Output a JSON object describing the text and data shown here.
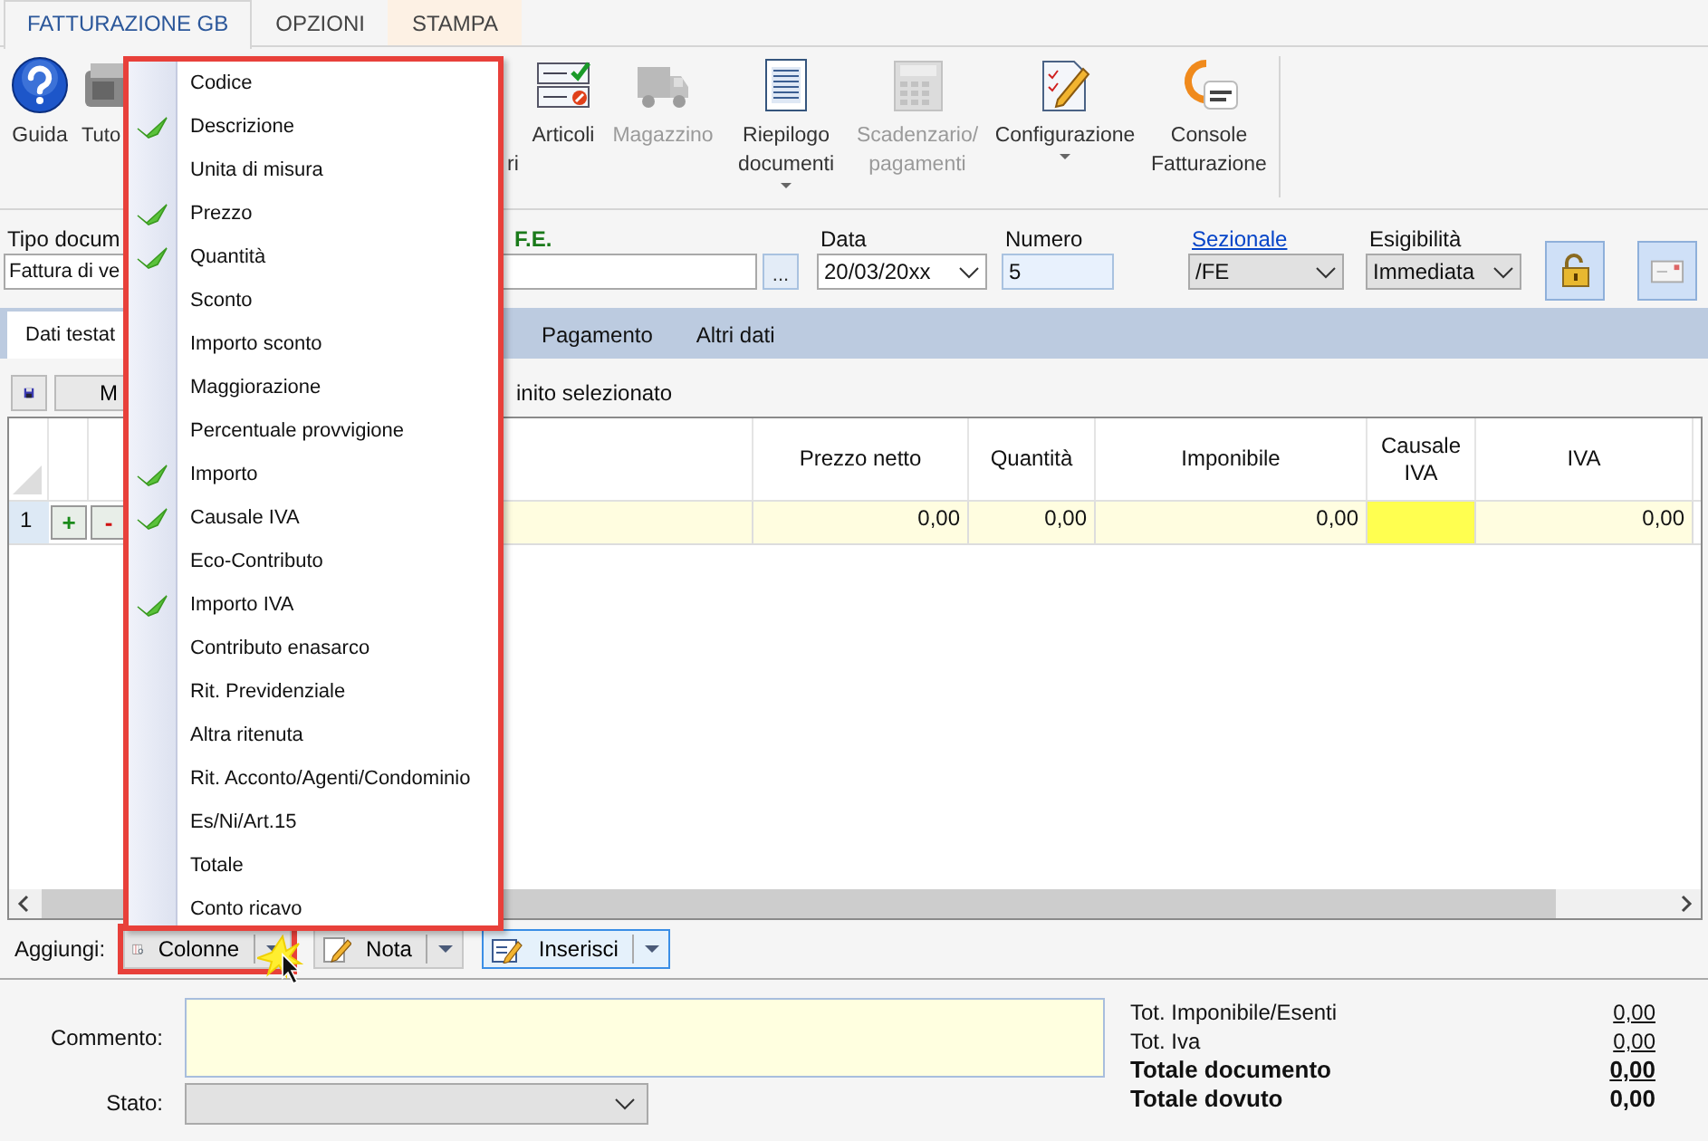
{
  "ribbon_tabs": [
    {
      "label": "FATTURAZIONE GB",
      "selected": true,
      "kind": "normal"
    },
    {
      "label": "OPZIONI",
      "selected": false,
      "kind": "normal"
    },
    {
      "label": "STAMPA",
      "selected": false,
      "kind": "contextual"
    }
  ],
  "ribbon_buttons": [
    {
      "kind": "help",
      "lines": [
        "Guida"
      ],
      "disabled": false,
      "dropdown": false
    },
    {
      "kind": "register",
      "lines": [
        "Tuto"
      ],
      "disabled": false,
      "dropdown": false
    },
    {
      "kind": "hidden",
      "lines": [
        "ri"
      ],
      "disabled": false,
      "dropdown": false
    },
    {
      "kind": "checklist",
      "lines": [
        "Articoli"
      ],
      "disabled": false,
      "dropdown": false
    },
    {
      "kind": "truck",
      "lines": [
        "Magazzino"
      ],
      "disabled": true,
      "dropdown": false
    },
    {
      "kind": "document",
      "lines": [
        "Riepilogo",
        "documenti"
      ],
      "disabled": false,
      "dropdown": true
    },
    {
      "kind": "calculator",
      "lines": [
        "Scadenzario/",
        "pagamenti"
      ],
      "disabled": true,
      "dropdown": false
    },
    {
      "kind": "pencil",
      "lines": [
        "Configurazione"
      ],
      "disabled": false,
      "dropdown": true
    },
    {
      "kind": "sdi",
      "lines": [
        "Console",
        "Fatturazione"
      ],
      "disabled": false,
      "dropdown": false
    }
  ],
  "header": {
    "document_type": {
      "label": "Tipo docum",
      "value": "Fattura di ve"
    },
    "fe": {
      "label": "F.E.",
      "browse": "..."
    },
    "date": {
      "label": "Data",
      "value": "20/03/20xx"
    },
    "number": {
      "label": "Numero",
      "value": "5"
    },
    "section": {
      "label": "Sezionale",
      "value": "/FE"
    },
    "payability": {
      "label": "Esigibilità",
      "value": "Immediata"
    }
  },
  "sub_tabs": [
    {
      "label": "Dati testat",
      "selected": true
    },
    {
      "label": "Pagamento",
      "selected": false
    },
    {
      "label": "Altri dati",
      "selected": false
    }
  ],
  "grid_toolbar": {
    "button": "M",
    "text": "inito selezionato"
  },
  "table": {
    "columns": [
      "Prezzo netto",
      "Quantità",
      "Imponibile",
      "Causale IVA",
      "IVA"
    ],
    "rows": [
      {
        "number": "1",
        "add": "+",
        "remove": "-",
        "cells": [
          {
            "value": "0,00",
            "required": false
          },
          {
            "value": "0,00",
            "required": false
          },
          {
            "value": "0,00",
            "required": false
          },
          {
            "required": true
          },
          {
            "value": "0,00",
            "required": false
          }
        ]
      }
    ]
  },
  "add_bar": {
    "label": "Aggiungi:",
    "buttons": [
      {
        "label": "Colonne",
        "kind": "columns",
        "highlighted": true,
        "focused": false
      },
      {
        "label": "Nota",
        "kind": "note",
        "highlighted": false,
        "focused": false
      },
      {
        "label": "Inserisci",
        "kind": "insert",
        "highlighted": false,
        "focused": true
      }
    ]
  },
  "column_menu": {
    "items": [
      {
        "label": "Codice",
        "checked": false
      },
      {
        "label": "Descrizione",
        "checked": true
      },
      {
        "label": "Unita di misura",
        "checked": false
      },
      {
        "label": "Prezzo",
        "checked": true
      },
      {
        "label": "Quantità",
        "checked": true
      },
      {
        "label": "Sconto",
        "checked": false
      },
      {
        "label": "Importo sconto",
        "checked": false
      },
      {
        "label": "Maggiorazione",
        "checked": false
      },
      {
        "label": "Percentuale provvigione",
        "checked": false
      },
      {
        "label": "Importo",
        "checked": true
      },
      {
        "label": "Causale IVA",
        "checked": true
      },
      {
        "label": "Eco-Contributo",
        "checked": false
      },
      {
        "label": "Importo IVA",
        "checked": true
      },
      {
        "label": "Contributo enasarco",
        "checked": false
      },
      {
        "label": "Rit. Previdenziale",
        "checked": false
      },
      {
        "label": "Altra ritenuta",
        "checked": false
      },
      {
        "label": "Rit. Acconto/Agenti/Condominio",
        "checked": false
      },
      {
        "label": "Es/Ni/Art.15",
        "checked": false
      },
      {
        "label": "Totale",
        "checked": false
      },
      {
        "label": "Conto ricavo",
        "checked": false
      }
    ]
  },
  "footer": {
    "comment_label": "Commento:",
    "status_label": "Stato:",
    "totals": [
      {
        "label": "Tot. Imponibile/Esenti",
        "value": "0,00",
        "bold": false,
        "link": true
      },
      {
        "label": "Tot. Iva",
        "value": "0,00",
        "bold": false,
        "link": true
      },
      {
        "label": "Totale documento",
        "value": "0,00",
        "bold": true,
        "link": true
      },
      {
        "label": "Totale dovuto",
        "value": "0,00",
        "bold": true,
        "link": false
      }
    ]
  }
}
